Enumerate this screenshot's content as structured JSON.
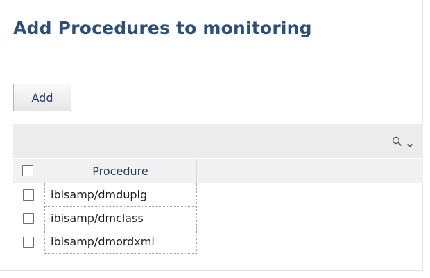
{
  "page": {
    "title": "Add Procedures to monitoring",
    "add_button_label": "Add"
  },
  "toolbar": {
    "search_icon": "search-icon",
    "dropdown_icon": "chevron-down-icon"
  },
  "grid": {
    "columns": [
      "Procedure"
    ],
    "rows": [
      {
        "procedure": "ibisamp/dmduplg",
        "checked": false
      },
      {
        "procedure": "ibisamp/dmclass",
        "checked": false
      },
      {
        "procedure": "ibisamp/dmordxml",
        "checked": false
      }
    ]
  },
  "colors": {
    "title": "#2b4f78",
    "toolbar_bg": "#ececec",
    "header_bg": "#f1f1f1"
  }
}
